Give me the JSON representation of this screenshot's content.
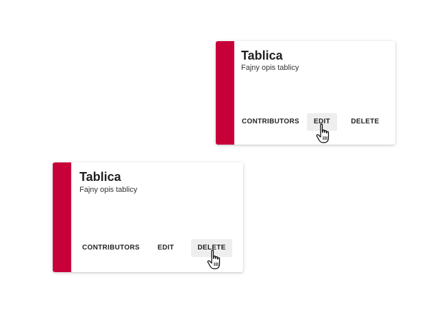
{
  "colors": {
    "accent": "#c8003a",
    "card_bg": "#ffffff",
    "hover_bg": "#eeeeee"
  },
  "cards": [
    {
      "title": "Tablica",
      "description": "Fajny opis tablicy",
      "buttons": {
        "contributors": "CONTRIBUTORS",
        "edit": "EDIT",
        "delete": "DELETE"
      },
      "hovered_button": "edit",
      "cursor_icon": "hand-pointer-icon"
    },
    {
      "title": "Tablica",
      "description": "Fajny opis tablicy",
      "buttons": {
        "contributors": "CONTRIBUTORS",
        "edit": "EDIT",
        "delete": "DELETE"
      },
      "hovered_button": "delete",
      "cursor_icon": "hand-pointer-icon"
    }
  ]
}
